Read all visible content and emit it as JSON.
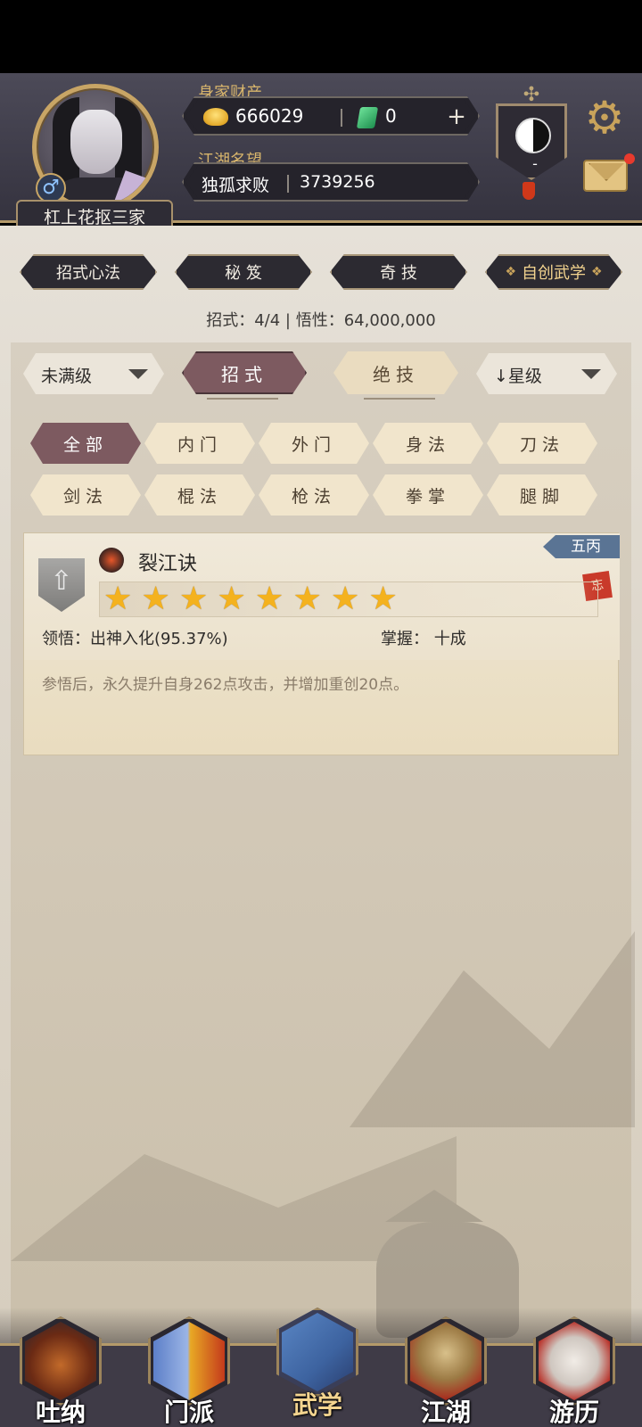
{
  "player": {
    "name": "杠上花抠三家",
    "gender_icon": "♂"
  },
  "header": {
    "wealth_label": "身家财产",
    "gold_amount": "666029",
    "gem_amount": "0",
    "plus_icon": "+",
    "fame_label": "江湖名望",
    "fame_title": "独孤求败",
    "fame_value": "3739256",
    "taiji_value": "-"
  },
  "tabs": [
    {
      "label": "招式心法"
    },
    {
      "label": "秘 笈"
    },
    {
      "label": "奇 技"
    },
    {
      "label": "自创武学"
    }
  ],
  "stats": {
    "line": "招式：4/4 | 悟性：64,000,000"
  },
  "filters": {
    "level_filter": "未满级",
    "sort_filter": "↓星级",
    "seg_moves": "招式",
    "seg_ultimate": "绝技"
  },
  "categories": [
    {
      "label": "全部"
    },
    {
      "label": "内门"
    },
    {
      "label": "外门"
    },
    {
      "label": "身法"
    },
    {
      "label": "刀法"
    },
    {
      "label": "剑法"
    },
    {
      "label": "棍法"
    },
    {
      "label": "枪法"
    },
    {
      "label": "拳掌"
    },
    {
      "label": "腿脚"
    }
  ],
  "skill": {
    "name": "裂江诀",
    "tag": "五丙",
    "seal": "忘",
    "stars": 8,
    "comprehension": "领悟：出神入化(95.37%)",
    "mastery": "掌握：  十成",
    "description": "参悟后，永久提升自身262点攻击，并增加重创20点。"
  },
  "nav": [
    {
      "label": "吐纳"
    },
    {
      "label": "门派"
    },
    {
      "label": "武学"
    },
    {
      "label": "江湖"
    },
    {
      "label": "游历"
    }
  ],
  "colors": {
    "accent_gold": "#c9a35b",
    "active_chip": "#7d5a60",
    "star": "#f4b21e"
  }
}
